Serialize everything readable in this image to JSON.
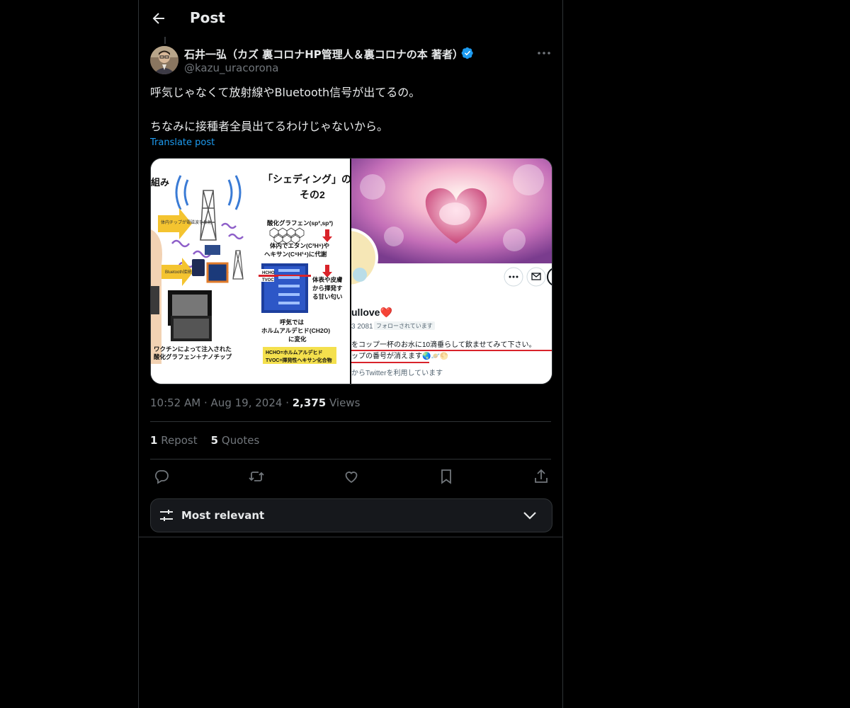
{
  "header": {
    "title": "Post"
  },
  "author": {
    "name": "石井一弘（カズ 裏コロナHP管理人＆裏コロナの本 著者）",
    "handle": "@kazu_uracorona"
  },
  "post": {
    "line1": "呼気じゃなくて放射線やBluetooth信号が出てるの。",
    "line2": "ちなみに接種者全員出てるわけじゃないから。",
    "translate_label": "Translate post"
  },
  "media_left": {
    "title_line1": "「シェディング」の仕",
    "title_line2": "その2",
    "corner_label": "組み",
    "graphene": "酸化グラフェン(sp²,sp³)",
    "ethane1": "体内でエタン(C²H⁶)や",
    "ethane2": "ヘキサン(C⁶H¹⁴)に代謝",
    "skin1": "体表や皮膚",
    "skin2": "から揮発す",
    "skin3": "る甘い匂い",
    "breath1": "呼気では",
    "breath2": "ホルムアルデヒド(CH2O)",
    "breath3": "に変化",
    "hcho": "HCHO=ホルムアルデヒド",
    "tvoc": "TVOC=揮発性ヘキサン化合物",
    "vaccine1": "ワクチンによって注入された",
    "vaccine2": "酸化グラフェン＋ナノチップ",
    "chip_label": "体内チップが電磁波を反射",
    "bt_label": "Bluetooth接続",
    "meter_hcho": "HCHO",
    "meter_tvoc": "TVOC"
  },
  "media_right": {
    "name_fragment": "ullove❤️",
    "id_fragment": "3 2081",
    "follows_badge": "フォローされています",
    "bio1": "をコップ一杯のお水に10滴垂らして飲ませてみて下さい。",
    "bio2": "ップの番号が消えます🌏🪐🌕",
    "joined": "からTwitterを利用しています"
  },
  "meta": {
    "time": "10:52 AM",
    "date": "Aug 19, 2024",
    "views_count": "2,375",
    "views_label": "Views",
    "sep": "·"
  },
  "stats": {
    "reposts_count": "1",
    "reposts_label": "Repost",
    "quotes_count": "5",
    "quotes_label": "Quotes"
  },
  "sort": {
    "label": "Most relevant"
  },
  "colors": {
    "background": "#000000",
    "accent": "#1d9bf0",
    "border": "#2f3336",
    "muted": "#71767b",
    "text": "#e7e9ea"
  },
  "icons": [
    "back-arrow-icon",
    "verified-badge-icon",
    "more-options-icon",
    "reply-icon",
    "repost-icon",
    "like-icon",
    "bookmark-icon",
    "share-icon",
    "sort-sliders-icon",
    "chevron-down-icon"
  ]
}
